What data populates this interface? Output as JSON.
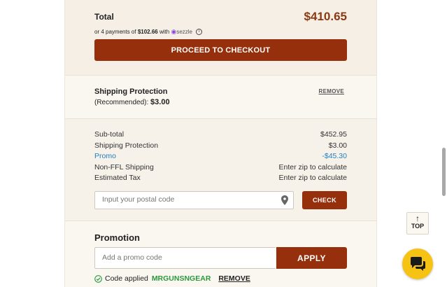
{
  "colors": {
    "accent": "#962f0b",
    "total_price": "#8a3a12",
    "promo_link": "#1f7fc0",
    "success": "#2b9a3d",
    "chat_button": "#f6c314"
  },
  "total": {
    "label": "Total",
    "value": "$410.65",
    "installments_prefix": "or 4 payments of",
    "installment_amount": "$102.66",
    "installments_with": "with",
    "provider": "sezzle",
    "info_icon": "info-icon"
  },
  "checkout": {
    "label": "PROCEED TO CHECKOUT"
  },
  "shipping_protection": {
    "title": "Shipping Protection",
    "recommended_label": "(Recommended):",
    "amount": "$3.00",
    "remove_label": "REMOVE"
  },
  "summary": {
    "rows": [
      {
        "label": "Sub-total",
        "value": "$452.95"
      },
      {
        "label": "Shipping Protection",
        "value": "$3.00"
      },
      {
        "label": "Promo",
        "value": "-$45.30"
      },
      {
        "label": "Non-FFL Shipping",
        "value": "Enter zip to calculate"
      },
      {
        "label": "Estimated Tax",
        "value": "Enter zip to calculate"
      }
    ],
    "postal_placeholder": "Input your postal code",
    "location_icon": "location-pin-icon",
    "check_label": "CHECK"
  },
  "promotion": {
    "title": "Promotion",
    "placeholder": "Add a promo code",
    "apply_label": "APPLY",
    "applied_prefix": "Code applied",
    "applied_code": "MRGUNSNGEAR",
    "remove_label": "REMOVE",
    "check_icon": "check-circle-icon"
  },
  "top_button": {
    "label": "TOP",
    "icon": "arrow-up-icon"
  },
  "chat_button": {
    "icon": "chat-bubble-icon"
  }
}
